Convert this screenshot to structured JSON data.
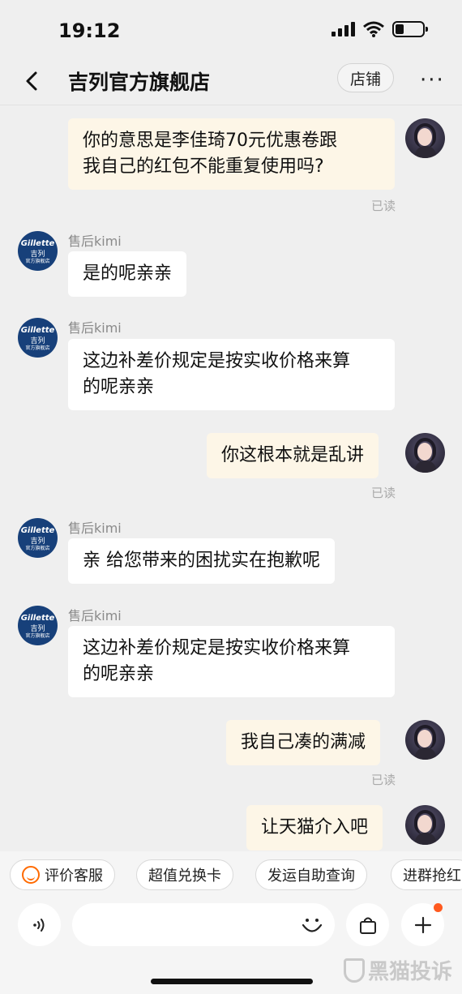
{
  "status": {
    "time": "19:12"
  },
  "header": {
    "title": "吉列官方旗舰店",
    "shop_button": "店铺",
    "more": "···"
  },
  "messages": [
    {
      "text_lines": [
        "你的意思是李佳琦70元优惠卷跟",
        "我自己的红包不能重复使用吗?"
      ],
      "status": "已读"
    },
    {
      "sender": "售后kimi",
      "text_lines": [
        "是的呢亲亲"
      ]
    },
    {
      "sender": "售后kimi",
      "text_lines": [
        "这边补差价规定是按实收价格来算",
        "的呢亲亲"
      ]
    },
    {
      "text_lines": [
        "你这根本就是乱讲"
      ],
      "status": "已读"
    },
    {
      "sender": "售后kimi",
      "text_lines": [
        "亲 给您带来的困扰实在抱歉呢"
      ]
    },
    {
      "sender": "售后kimi",
      "text_lines": [
        "这边补差价规定是按实收价格来算",
        "的呢亲亲"
      ]
    },
    {
      "text_lines": [
        "我自己凑的满减"
      ],
      "status": "已读"
    },
    {
      "text_lines": [
        "让天猫介入吧"
      ]
    }
  ],
  "shop_avatar": {
    "brand": "Gillette",
    "cn": "吉列",
    "sub": "官方旗舰店"
  },
  "quick_replies": [
    "评价客服",
    "超值兑换卡",
    "发运自助查询",
    "进群抢红"
  ],
  "icons": {
    "back": "chevron-left-icon",
    "voice": "voice-icon",
    "emoji": "emoji-icon",
    "bag": "shopping-bag-icon",
    "plus": "plus-icon"
  },
  "colors": {
    "out_bubble": "#fdf6e7",
    "in_bubble": "#ffffff",
    "accent": "#ff6a00",
    "background": "#efefef"
  },
  "watermark": "黑猫投诉"
}
